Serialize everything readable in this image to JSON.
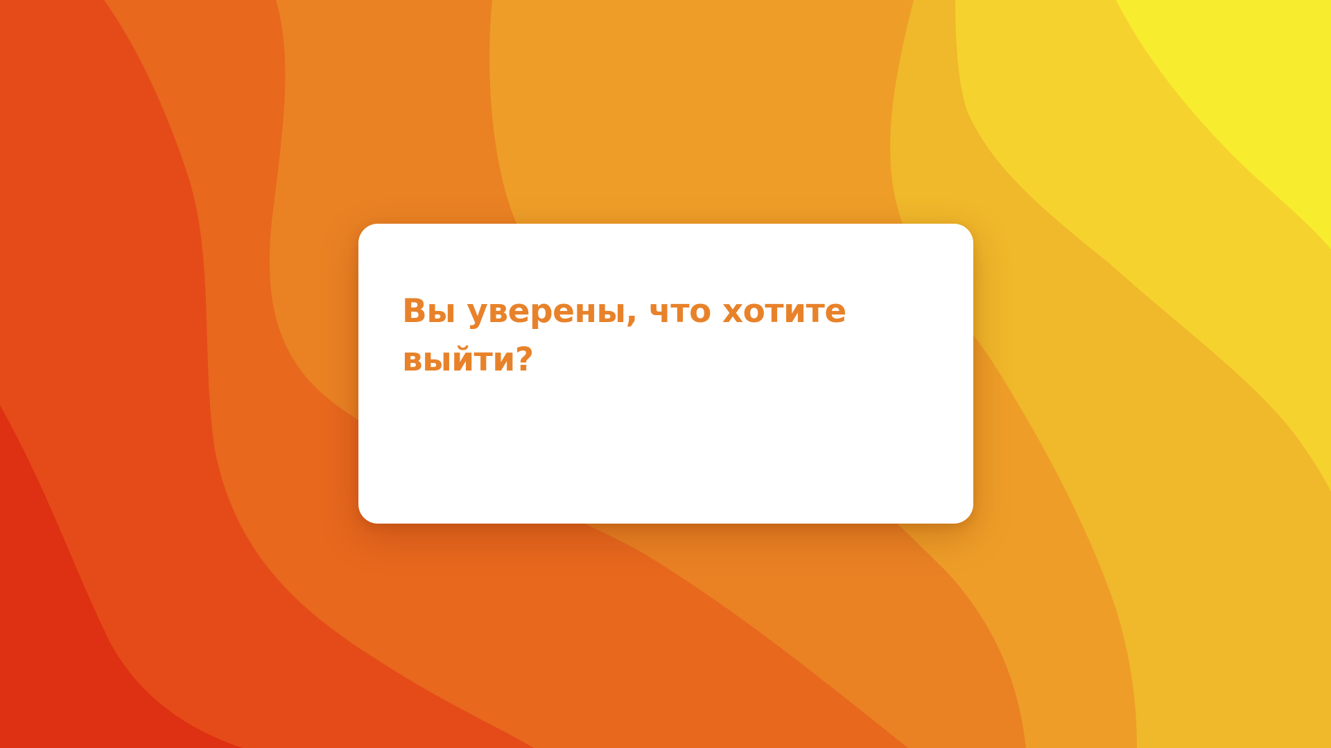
{
  "dialog": {
    "title": "Вы уверены, что хотите выйти?"
  },
  "colors": {
    "accent_text": "#E8822A",
    "dialog_background": "#FFFFFF",
    "background_bands": [
      "#DE3012",
      "#E54B19",
      "#E8681E",
      "#EA8224",
      "#EE9E28",
      "#F0B82B",
      "#F6D22F",
      "#F8EC2E"
    ]
  }
}
